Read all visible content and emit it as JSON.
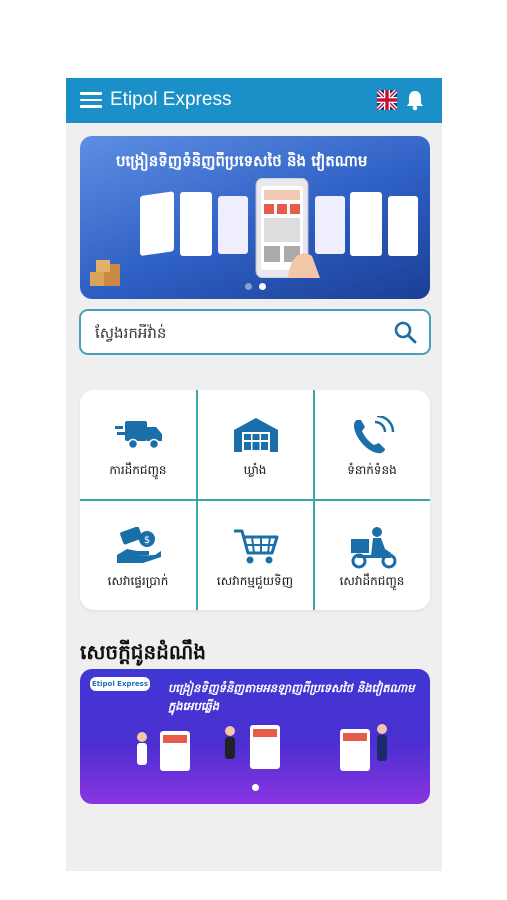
{
  "app": {
    "title": "Etipol Express"
  },
  "header": {
    "menu_icon": "hamburger-menu-icon",
    "language_icon": "uk-flag-icon",
    "notification_icon": "bell-icon"
  },
  "banner": {
    "headline": "បង្រៀនទិញទំនិញពីប្រទេសថៃ និង វៀតណាម",
    "slide_count": 2,
    "active_slide": 2
  },
  "search": {
    "placeholder": "ស្វែងរកអីវ៉ាន់",
    "icon": "search-icon"
  },
  "services": [
    {
      "label": "ការដឹកជញ្ជូន",
      "icon": "delivery-truck-icon"
    },
    {
      "label": "ឃ្លាំង",
      "icon": "warehouse-icon"
    },
    {
      "label": "ទំនាក់ទំនង",
      "icon": "phone-call-icon"
    },
    {
      "label": "សេវាផ្ទេរប្រាក់",
      "icon": "money-transfer-icon"
    },
    {
      "label": "សេវាកម្មជួយទិញ",
      "icon": "shopping-cart-icon"
    },
    {
      "label": "សេវាដឹកជញ្ជូន",
      "icon": "delivery-scooter-icon"
    }
  ],
  "notifications": {
    "title": "សេចក្តីជូនដំណឹង",
    "promo_logo": "Etipol Express",
    "promo_text": "បង្រៀនទិញទំនិញតាមអនឡាញពីប្រទេសថៃ និងវៀតណាមក្នុងអេបឆ្លើង",
    "slide_count": 1,
    "active_slide": 1
  },
  "colors": {
    "app_bar": "#1a8fc8",
    "grid_lines": "#3aa6a6",
    "icon": "#1a6fa8",
    "background": "#efefef"
  }
}
